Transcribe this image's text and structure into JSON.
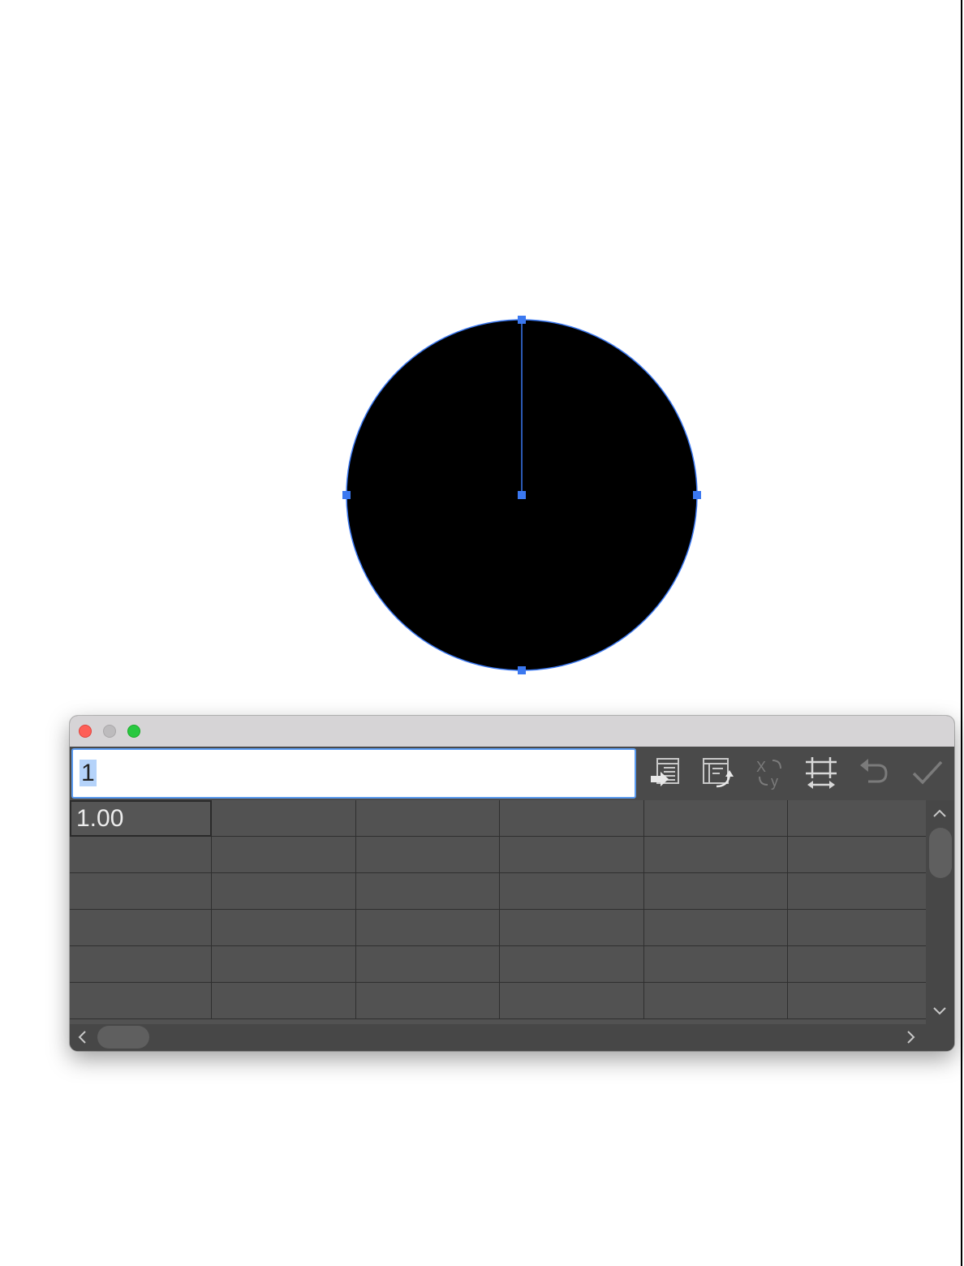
{
  "pie_graph": {
    "fill_color": "#000000",
    "selection_color": "#3b78f0",
    "chart_data": {
      "type": "pie",
      "values": [
        1.0
      ]
    }
  },
  "graph_data_window": {
    "window_controls": [
      "close",
      "minimize",
      "zoom"
    ],
    "cell_entry_value": "1",
    "toolbar": [
      {
        "name": "import-data",
        "icon": "import-data-icon",
        "enabled": true
      },
      {
        "name": "transpose-row-column",
        "icon": "transpose-icon",
        "enabled": true
      },
      {
        "name": "switch-xy",
        "icon": "switch-xy-icon",
        "enabled": false
      },
      {
        "name": "cell-style",
        "icon": "cell-style-icon",
        "enabled": true
      },
      {
        "name": "revert",
        "icon": "revert-icon",
        "enabled": false
      },
      {
        "name": "apply",
        "icon": "checkmark-icon",
        "enabled": false
      }
    ],
    "grid": {
      "rows": [
        [
          "1.00",
          "",
          "",
          "",
          "",
          ""
        ],
        [
          "",
          "",
          "",
          "",
          "",
          ""
        ],
        [
          "",
          "",
          "",
          "",
          "",
          ""
        ],
        [
          "",
          "",
          "",
          "",
          "",
          ""
        ],
        [
          "",
          "",
          "",
          "",
          "",
          ""
        ],
        [
          "",
          "",
          "",
          "",
          "",
          ""
        ]
      ]
    }
  }
}
